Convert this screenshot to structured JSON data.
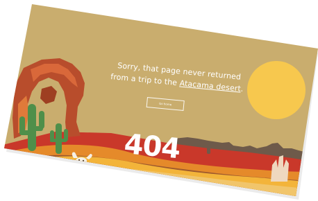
{
  "message": {
    "line1": "Sorry, that page never returned",
    "line2_prefix": "from a trip to the ",
    "line2_link": "Atacama desert",
    "line2_suffix": "."
  },
  "home_button": {
    "label": "Go home"
  },
  "error_code": "404",
  "colors": {
    "sky": "#c9ad6e",
    "sun": "#f7c84e",
    "dune_yellow": "#f3b43a",
    "dune_orange": "#e58a2a",
    "red_layer": "#c9382a",
    "rock": "#b84d2c",
    "cactus": "#4f8f4a",
    "silhouette": "#6e5a4a"
  }
}
